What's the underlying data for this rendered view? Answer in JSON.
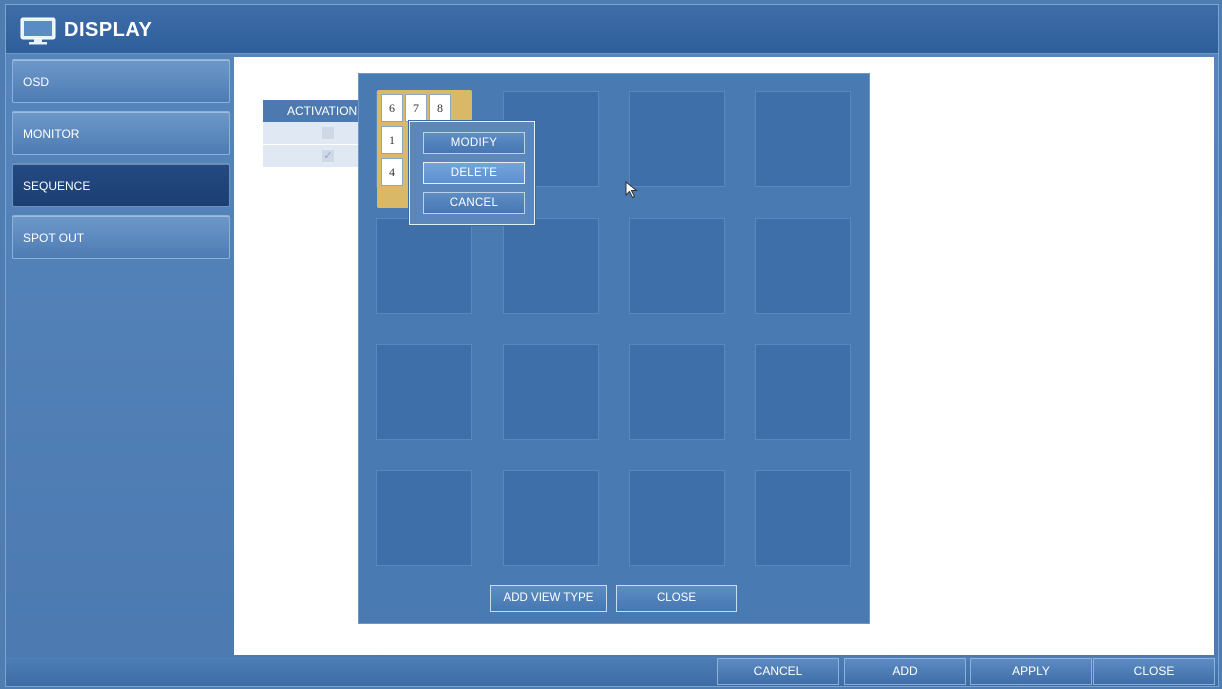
{
  "window": {
    "title": "DISPLAY",
    "icon": "monitor-icon"
  },
  "sidebar": {
    "items": [
      {
        "label": "OSD",
        "active": false
      },
      {
        "label": "MONITOR",
        "active": false
      },
      {
        "label": "SEQUENCE",
        "active": true
      },
      {
        "label": "SPOT OUT",
        "active": false
      }
    ]
  },
  "table": {
    "header": "ACTIVATION",
    "rows": [
      {
        "checked": false
      },
      {
        "checked": true
      }
    ]
  },
  "view_grid": {
    "numbers_top": [
      "6",
      "7",
      "8"
    ],
    "numbers_side": [
      "1",
      "4"
    ],
    "context_menu": {
      "modify": "MODIFY",
      "delete": "DELETE",
      "cancel": "CANCEL"
    },
    "add_view_type": "ADD VIEW TYPE",
    "close": "CLOSE"
  },
  "footer": {
    "cancel": "CANCEL",
    "add": "ADD",
    "apply": "APPLY",
    "close": "CLOSE"
  },
  "colors": {
    "background": "#4f7db2",
    "active_item": "#1f457c",
    "highlight": "#d9b968"
  }
}
